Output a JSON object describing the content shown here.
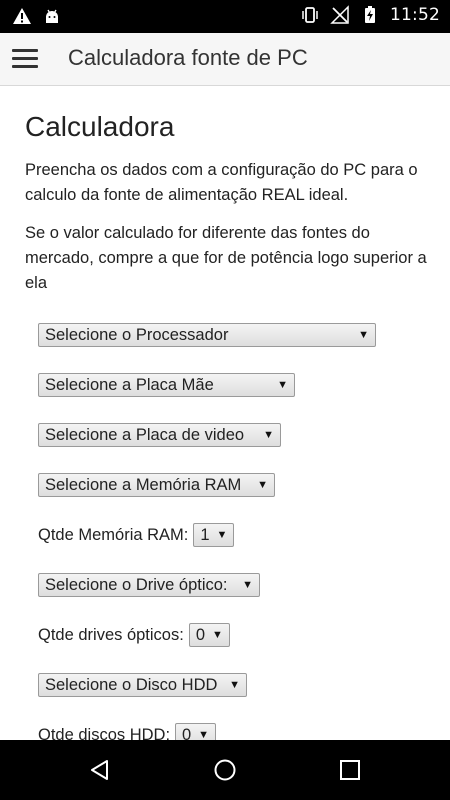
{
  "status_bar": {
    "time": "11:52",
    "icons": [
      "warning-icon",
      "android-icon",
      "vibrate-icon",
      "no-signal-icon",
      "battery-charging-icon"
    ]
  },
  "app_bar": {
    "title": "Calculadora fonte de PC",
    "menu_icon": "hamburger-menu-icon"
  },
  "content": {
    "heading": "Calculadora",
    "paragraph1": "Preencha os dados com a configuração do PC para o calculo da fonte de alimentação REAL ideal.",
    "paragraph2": "Se o valor calculado for diferente das fontes do mercado, compre a que for de potência logo superior a ela",
    "processor_select": "Selecione o Processador",
    "motherboard_select": "Selecione a Placa Mãe",
    "video_select": "Selecione a Placa de video",
    "ram_select": "Selecione a Memória RAM",
    "ram_qty_label": "Qtde Memória RAM:",
    "ram_qty_value": "1",
    "optical_select": "Selecione o Drive óptico:",
    "optical_qty_label": "Qtde drives ópticos:",
    "optical_qty_value": "0",
    "hdd_select": "Selecione o Disco HDD",
    "hdd_qty_label": "Qtde discos HDD:",
    "hdd_qty_value": "0"
  },
  "nav_bar": {
    "icons": [
      "back-icon",
      "home-icon",
      "recents-icon"
    ]
  },
  "colors": {
    "status_bar": "#000000",
    "app_bar": "#f6f6f6",
    "nav_bar": "#000000"
  }
}
